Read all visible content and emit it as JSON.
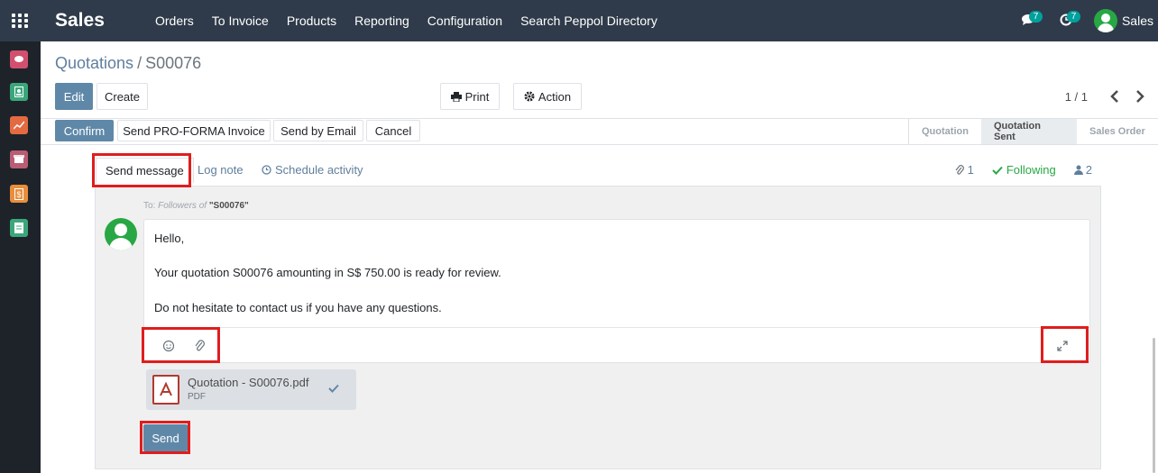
{
  "topnav": {
    "brand": "Sales",
    "menu": [
      "Orders",
      "To Invoice",
      "Products",
      "Reporting",
      "Configuration",
      "Search Peppol Directory"
    ],
    "messages_badge": "7",
    "activities_badge": "7",
    "user_name": "Sales"
  },
  "sidebar": {
    "apps": [
      {
        "name": "discuss-app-icon",
        "color": "#d1506f"
      },
      {
        "name": "contacts-app-icon",
        "color": "#3aa77b"
      },
      {
        "name": "crm-app-icon",
        "color": "#e46b41"
      },
      {
        "name": "inventory-app-icon",
        "color": "#b85d73"
      },
      {
        "name": "invoicing-app-icon",
        "color": "#e88e3c"
      },
      {
        "name": "documents-app-icon",
        "color": "#3aa77b"
      }
    ]
  },
  "breadcrumb": {
    "parent": "Quotations",
    "separator": "/",
    "current": "S00076"
  },
  "actions": {
    "edit": "Edit",
    "create": "Create",
    "print": "Print",
    "action": "Action"
  },
  "pager": {
    "value": "1 / 1"
  },
  "statusbar": {
    "buttons": [
      "Confirm",
      "Send PRO-FORMA Invoice",
      "Send by Email",
      "Cancel"
    ],
    "stages": [
      "Quotation",
      "Quotation Sent",
      "Sales Order"
    ],
    "active_stage": "Quotation Sent"
  },
  "chatter": {
    "tabs": {
      "send_message": "Send message",
      "log_note": "Log note",
      "schedule_activity": "Schedule activity"
    },
    "attachments_count": "1",
    "following": "Following",
    "followers_count": "2",
    "to_prefix": "To:",
    "to_followers": "Followers of",
    "to_record": "\"S00076\"",
    "body": {
      "line1": "Hello,",
      "line2": "Your quotation S00076 amounting in S$ 750.00 is ready for review.",
      "line3": "Do not hesitate to contact us if you have any questions."
    },
    "attachment": {
      "name": "Quotation - S00076.pdf",
      "type": "PDF"
    },
    "send": "Send"
  },
  "colors": {
    "highlight": "#e01d1d",
    "primary": "#5f88a8",
    "following": "#28a745",
    "navbar": "#2f3b4a"
  }
}
